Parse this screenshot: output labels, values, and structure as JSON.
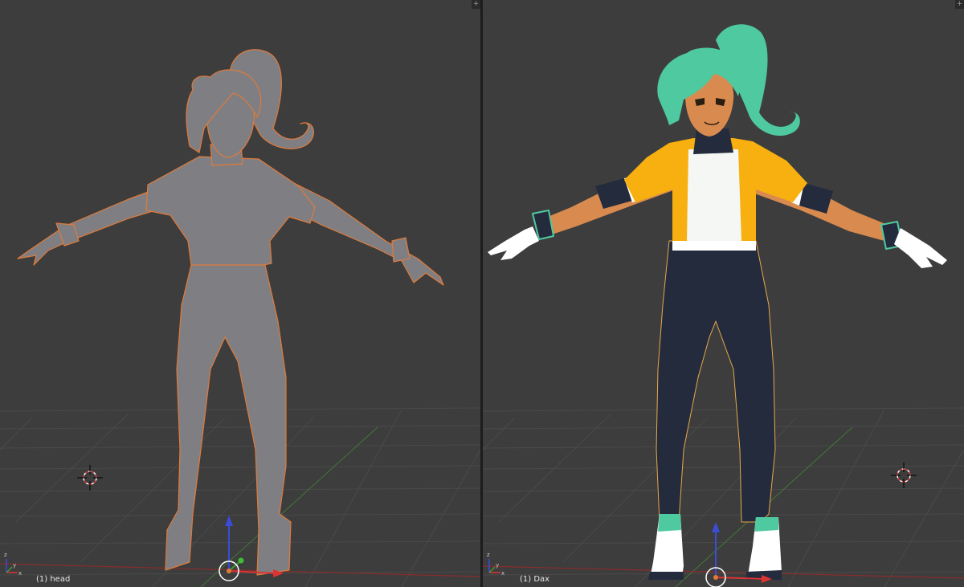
{
  "viewports": {
    "left": {
      "object_label": "(1) head",
      "corner_widget": "+"
    },
    "right": {
      "object_label": "(1) Dax",
      "corner_widget": "+"
    }
  },
  "icons": {
    "cursor": "3d-cursor-icon",
    "gizmo": "transform-gizmo-icon",
    "axes": "axis-orientation-icon"
  },
  "colors": {
    "viewport_bg": "#3d3d3d",
    "grid": "#4a4a4a",
    "x_axis": "#8a2c2c",
    "y_axis": "#3f7a35",
    "selection_outline": "#e07a3a",
    "hair": "#4fc9a0",
    "jacket": "#f7b010",
    "pants": "#232b3d",
    "skin": "#d88a4f",
    "clay": "#7d7d80"
  }
}
